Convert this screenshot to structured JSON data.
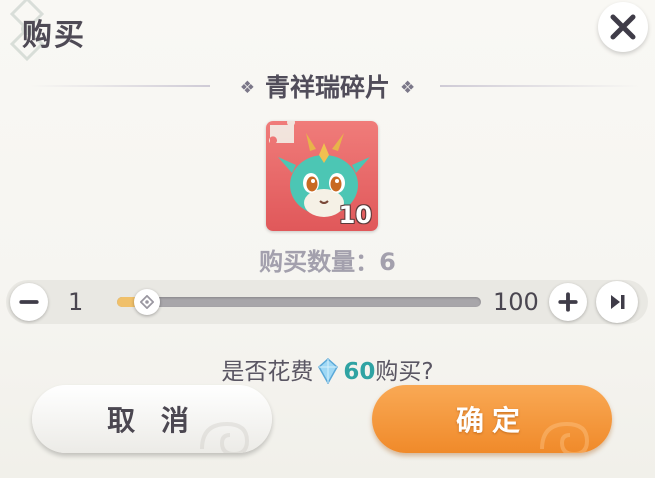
{
  "dialog": {
    "title": "购买",
    "item_name": "青祥瑞碎片",
    "item_count": "10",
    "item_icon": "dragon-shard-icon",
    "quantity_label": "购买数量：6",
    "slider": {
      "min_label": "1",
      "max_label": "100",
      "min": 1,
      "max": 100,
      "value": 6
    },
    "cost": {
      "prefix": "是否花费",
      "amount": "60",
      "suffix": "购买?",
      "currency_icon": "crystal-icon"
    },
    "buttons": {
      "cancel": "取 消",
      "confirm": "确定"
    }
  },
  "colors": {
    "accent_orange": "#f08a2a",
    "cost_teal": "#2fa3a3",
    "icon_background": "#e0585a",
    "slider_fill": "#f0c06a"
  }
}
